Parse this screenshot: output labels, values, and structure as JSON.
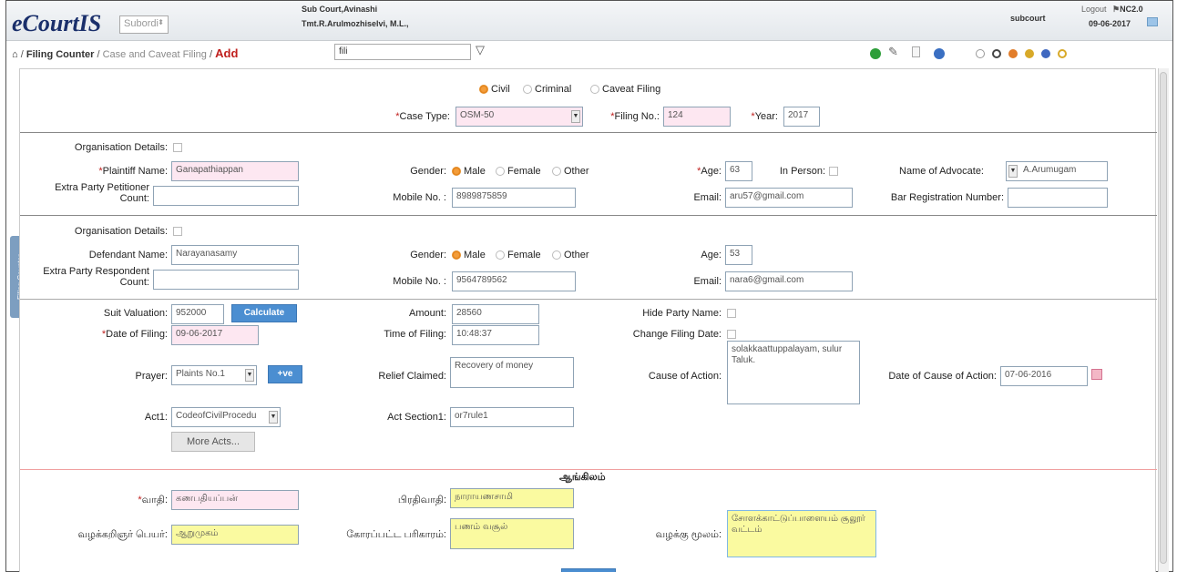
{
  "header": {
    "logo": "eCourtIS",
    "court_select": "Subordi",
    "court_name": "Sub Court,Avinashi",
    "judge_name": "Tmt.R.Arulmozhiselvi, M.L.,",
    "user": "subcourt",
    "logout": "Logout",
    "nc": "NC2.0",
    "date": "09-06-2017"
  },
  "breadcrumb": {
    "home": "Filing Counter",
    "middle": "Case and Caveat Filing",
    "current": "Add",
    "search_value": "fili"
  },
  "filing_type": {
    "options": [
      "Civil",
      "Criminal",
      "Caveat Filing"
    ],
    "selected": "Civil"
  },
  "case": {
    "case_type_label": "Case Type:",
    "case_type_value": "OSM-50",
    "filing_no_label": "Filing No.:",
    "filing_no_value": "124",
    "year_label": "Year:",
    "year_value": "2017"
  },
  "plaintiff": {
    "org_label": "Organisation Details:",
    "name_label": "Plaintiff Name:",
    "name_value": "Ganapathiappan",
    "gender_label": "Gender:",
    "gender_options": [
      "Male",
      "Female",
      "Other"
    ],
    "age_label": "Age:",
    "age_value": "63",
    "in_person_label": "In Person:",
    "advocate_label": "Name of Advocate:",
    "advocate_value": "A.Arumugam",
    "extra_label_1": "Extra Party Petitioner",
    "extra_label_2": "Count:",
    "mobile_label": "Mobile No. :",
    "mobile_value": "8989875859",
    "email_label": "Email:",
    "email_value": "aru57@gmail.com",
    "bar_label": "Bar Registration Number:"
  },
  "defendant": {
    "org_label": "Organisation Details:",
    "name_label": "Defendant Name:",
    "name_value": "Narayanasamy",
    "gender_label": "Gender:",
    "gender_options": [
      "Male",
      "Female",
      "Other"
    ],
    "age_label": "Age:",
    "age_value": "53",
    "extra_label_1": "Extra Party Respondent",
    "extra_label_2": "Count:",
    "mobile_label": "Mobile No. :",
    "mobile_value": "9564789562",
    "email_label": "Email:",
    "email_value": "nara6@gmail.com"
  },
  "suit": {
    "valuation_label": "Suit Valuation:",
    "valuation_value": "952000",
    "calculate": "Calculate",
    "amount_label": "Amount:",
    "amount_value": "28560",
    "hide_party_label": "Hide Party Name:",
    "date_filing_label": "Date of Filing:",
    "date_filing_value": "09-06-2017",
    "time_filing_label": "Time of Filing:",
    "time_filing_value": "10:48:37",
    "change_date_label": "Change Filing Date:",
    "prayer_label": "Prayer:",
    "prayer_value": "Plaints No.1",
    "prayer_btn": "+ve",
    "relief_label": "Relief Claimed:",
    "relief_value": "Recovery of money",
    "cause_label": "Cause of Action:",
    "cause_value": "solakkaattuppalayam, sulur Taluk.",
    "cause_date_label": "Date of Cause of Action:",
    "cause_date_value": "07-06-2016",
    "act_label": "Act1:",
    "act_value": "CodeofCivilProcedu",
    "act_section_label": "Act Section1:",
    "act_section_value": "or7rule1",
    "more_acts": "More Acts..."
  },
  "tamil": {
    "heading": "ஆங்கிலம்",
    "vadi_label": "வாதி:",
    "vadi_value": "கணபதியப்பன்",
    "prathivadi_label": "பிரதிவாதி:",
    "prathivadi_value": "நாராயணசாமி",
    "advocate_label": "வழக்கறிஞர் பெயர்:",
    "advocate_value": "ஆறுமுகம்",
    "relief_label": "கோரப்பட்ட பரிகாரம்:",
    "relief_value": "பணம் வசூல்",
    "cause_label": "வழக்கு மூலம்:",
    "cause_value": "சோளக்காட்டுப்பாளையம் சூலூர் வட்டம்"
  },
  "side_tab": "Filing Counter"
}
